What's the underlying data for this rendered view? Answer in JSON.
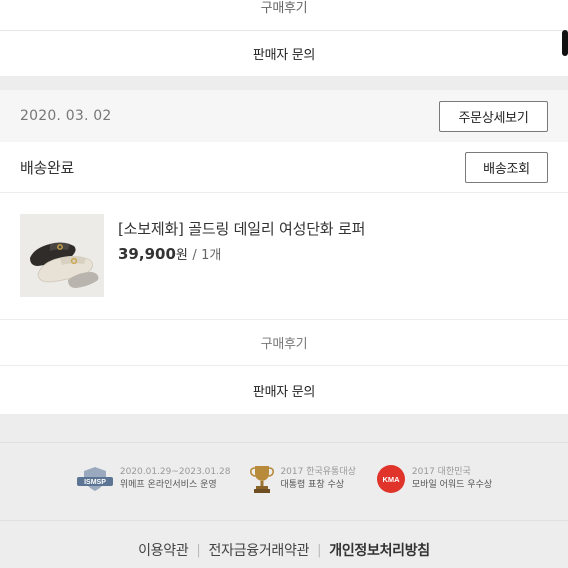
{
  "top_card": {
    "review_label": "구매후기",
    "inquiry_label": "판매자 문의"
  },
  "order": {
    "date": "2020. 03. 02",
    "detail_button": "주문상세보기",
    "status": "배송완료",
    "tracking_button": "배송조회",
    "product": {
      "name": "[소보제화] 골드링 데일리 여성단화 로퍼",
      "price": "39,900",
      "price_unit": "원",
      "qty_separator": "/",
      "quantity": "1개"
    },
    "review_label": "구매후기",
    "inquiry_label": "판매자 문의"
  },
  "footer": {
    "badges": [
      {
        "icon": "ismsp-logo",
        "line1": "2020.01.29~2023.01.28",
        "line2": "위메프 온라인서비스 운영",
        "logo_text": "ISMSP"
      },
      {
        "icon": "trophy-icon",
        "line1": "2017 한국유통대상",
        "line2": "대통령 표창 수상"
      },
      {
        "icon": "kma-logo",
        "line1": "2017 대한민국",
        "line2": "모바일 어워드 우수상",
        "logo_text": "KMA"
      }
    ],
    "links": {
      "terms": "이용약관",
      "finance_terms": "전자금융거래약관",
      "privacy": "개인정보처리방침",
      "separator": "|"
    }
  },
  "colors": {
    "page_bg": "#ededed",
    "card_bg": "#ffffff",
    "header_bg": "#f6f6f6",
    "border": "#e6e6e6"
  }
}
